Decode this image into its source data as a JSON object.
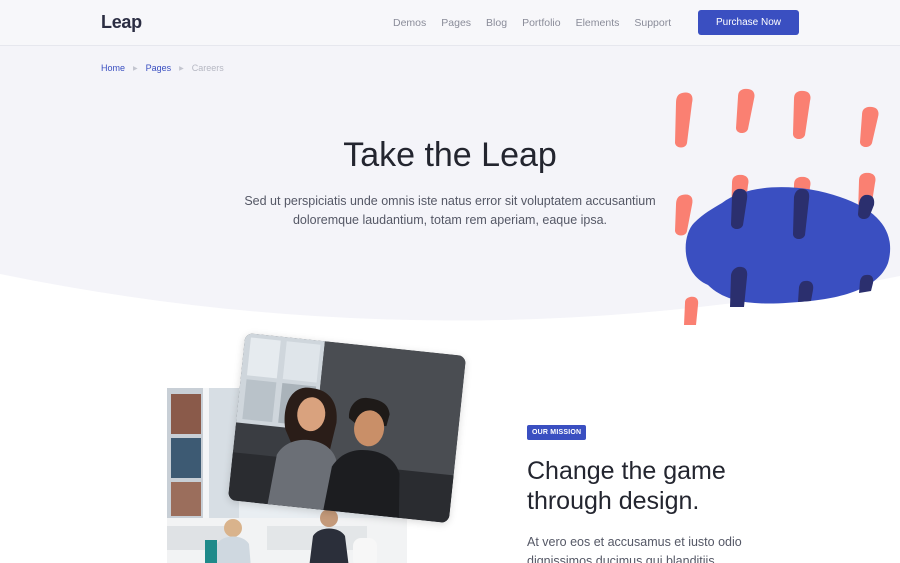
{
  "brand": {
    "name": "Leap",
    "accent": "#3a4fc1",
    "coral": "#fa8072"
  },
  "nav": {
    "items": [
      "Demos",
      "Pages",
      "Blog",
      "Portfolio",
      "Elements",
      "Support"
    ],
    "cta_label": "Purchase Now"
  },
  "breadcrumb": {
    "home": "Home",
    "pages": "Pages",
    "current": "Careers"
  },
  "hero": {
    "title": "Take the Leap",
    "subtitle_line1": "Sed ut perspiciatis unde omnis iste natus error sit voluptatem accusantium",
    "subtitle_line2": "doloremque laudantium, totam rem aperiam, eaque ipsa."
  },
  "mission": {
    "badge": "OUR MISSION",
    "title_line1": "Change the game",
    "title_line2": "through design.",
    "body_line1": "At vero eos et accusamus et iusto odio",
    "body_line2": "dignissimos ducimus qui blanditiis"
  }
}
